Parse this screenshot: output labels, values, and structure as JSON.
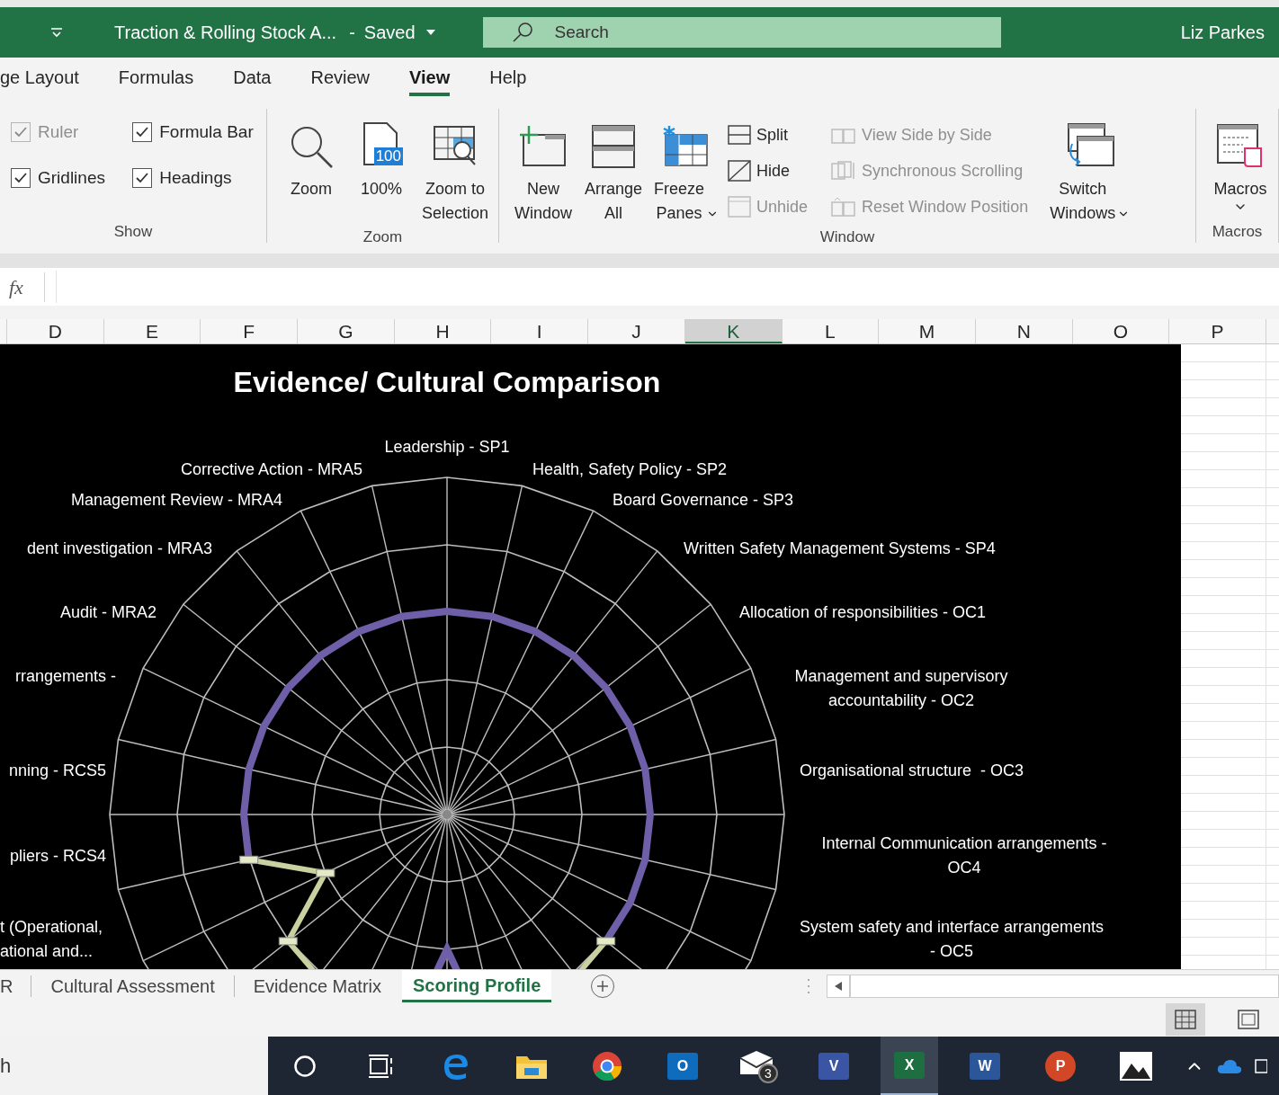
{
  "title_bar": {
    "document": "Traction & Rolling Stock A...",
    "separator": "-",
    "status": "Saved",
    "search": {
      "placeholder": "Search"
    },
    "user": "Liz Parkes"
  },
  "ribbon": {
    "tabs": [
      {
        "label": "ge Layout",
        "selected": false
      },
      {
        "label": "Formulas",
        "selected": false
      },
      {
        "label": "Data",
        "selected": false
      },
      {
        "label": "Review",
        "selected": false
      },
      {
        "label": "View",
        "selected": true
      },
      {
        "label": "Help",
        "selected": false
      }
    ],
    "groups": [
      {
        "kind": "show",
        "label": "Show",
        "checkboxes": [
          {
            "label": "Ruler",
            "checked": true,
            "disabled": true
          },
          {
            "label": "Formula Bar",
            "checked": true,
            "disabled": false
          },
          {
            "label": "Gridlines",
            "checked": true,
            "disabled": false
          },
          {
            "label": "Headings",
            "checked": true,
            "disabled": false
          }
        ]
      },
      {
        "kind": "zoom",
        "label": "Zoom",
        "items": [
          {
            "kind": "large",
            "label": "Zoom",
            "dropdown": false
          },
          {
            "kind": "large",
            "label": "100%",
            "badge": "100",
            "dropdown": false
          },
          {
            "kind": "large",
            "label": "Zoom to\nSelection",
            "dropdown": false
          }
        ]
      },
      {
        "kind": "window",
        "label": "Window",
        "items": [
          {
            "kind": "large",
            "label": "New\nWindow",
            "dropdown": false
          },
          {
            "kind": "large",
            "label": "Arrange\nAll",
            "dropdown": false
          },
          {
            "kind": "large",
            "label": "Freeze\nPanes",
            "dropdown": true
          },
          {
            "kind": "stack",
            "items": [
              {
                "label": "Split",
                "disabled": false
              },
              {
                "label": "Hide",
                "disabled": false
              },
              {
                "label": "Unhide",
                "disabled": true
              }
            ]
          },
          {
            "kind": "stack",
            "items": [
              {
                "label": "View Side by Side",
                "disabled": true
              },
              {
                "label": "Synchronous Scrolling",
                "disabled": true
              },
              {
                "label": "Reset Window Position",
                "disabled": true
              }
            ]
          },
          {
            "kind": "large",
            "label": "Switch\nWindows",
            "dropdown": true
          }
        ]
      },
      {
        "kind": "macros",
        "label": "Macros",
        "items": [
          {
            "kind": "large",
            "label": "Macros",
            "dropdown": true
          }
        ]
      }
    ]
  },
  "formula_bar": {
    "function_label": "fx"
  },
  "columns": [
    {
      "label": "D",
      "selected": false
    },
    {
      "label": "E",
      "selected": false
    },
    {
      "label": "F",
      "selected": false
    },
    {
      "label": "G",
      "selected": false
    },
    {
      "label": "H",
      "selected": false
    },
    {
      "label": "I",
      "selected": false
    },
    {
      "label": "J",
      "selected": false
    },
    {
      "label": "K",
      "selected": true
    },
    {
      "label": "L",
      "selected": false
    },
    {
      "label": "M",
      "selected": false
    },
    {
      "label": "N",
      "selected": false
    },
    {
      "label": "O",
      "selected": false
    },
    {
      "label": "P",
      "selected": false
    }
  ],
  "chart": {
    "title": "Evidence/ Cultural Comparison",
    "labels": [
      "Leadership - SP1",
      "Health, Safety Policy - SP2",
      "Board Governance - SP3",
      "Written Safety Management Systems - SP4",
      "Allocation of responsibilities - OC1",
      "Management and supervisory\naccountability - OC2",
      "Organisational structure  - OC3",
      "Internal Communication arrangements -\nOC4",
      "System safety and interface arrangements\n- OC5",
      "Corrective Action - MRA5",
      "Management Review - MRA4",
      "dent investigation - MRA3",
      "Audit - MRA2",
      "rrangements -",
      "nning - RCS5",
      "pliers - RCS4",
      "t (Operational,\national and..."
    ]
  },
  "sheet_tabs": [
    {
      "label": "R",
      "selected": false
    },
    {
      "label": "Cultural Assessment",
      "selected": false
    },
    {
      "label": "Evidence Matrix",
      "selected": false
    },
    {
      "label": "Scoring Profile",
      "selected": true
    }
  ],
  "status_bar": {
    "views": [
      {
        "selected": true
      },
      {
        "selected": false
      }
    ]
  },
  "taskbar": {
    "search_text": "h",
    "items": [
      {
        "kind": "cortana",
        "selected": false
      },
      {
        "kind": "taskview",
        "selected": false
      },
      {
        "kind": "edge",
        "selected": false
      },
      {
        "kind": "folder",
        "selected": false
      },
      {
        "kind": "chrome",
        "selected": false
      },
      {
        "kind": "tile",
        "label": "O",
        "color": "#0f6cbd",
        "selected": false
      },
      {
        "kind": "mail",
        "badge": "3",
        "selected": false
      },
      {
        "kind": "tile",
        "label": "V",
        "color": "#3955a3",
        "selected": false
      },
      {
        "kind": "tile",
        "label": "X",
        "color": "#1d6f42",
        "selected": true
      },
      {
        "kind": "tile",
        "label": "W",
        "color": "#2b579a",
        "selected": false
      },
      {
        "kind": "round",
        "label": "P",
        "color": "#d24726",
        "selected": false
      },
      {
        "kind": "photos",
        "selected": false
      }
    ]
  }
}
